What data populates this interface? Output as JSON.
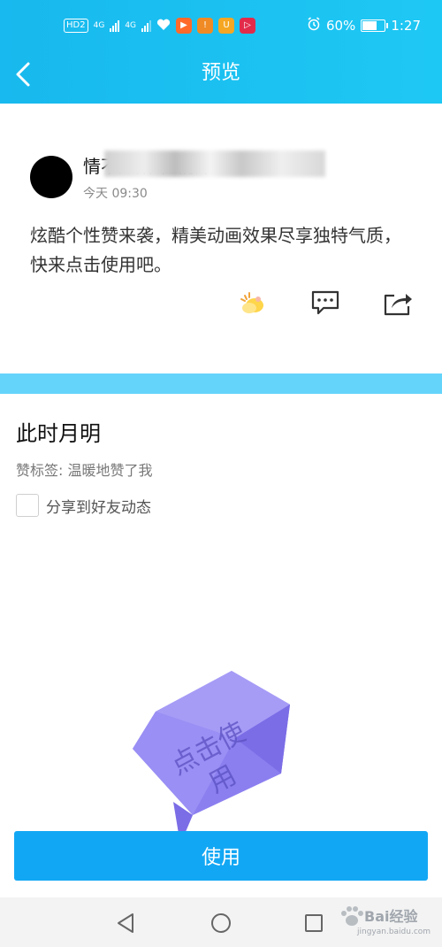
{
  "status_bar": {
    "network_label": "HD",
    "network_sub": "2",
    "signal_1": "4G",
    "signal_2": "4G",
    "battery": "60%",
    "time": "1:27"
  },
  "header": {
    "title": "预览"
  },
  "post": {
    "author_visible": "情不知所    住情深",
    "time": "今天 09:30",
    "text": "炫酷个性赞来袭，精美动画效果尽享独特气质，快来点击使用吧。"
  },
  "detail": {
    "title": "此时月明",
    "tag": "赞标签: 温暖地赞了我",
    "share_label": "分享到好友动态",
    "share_checked": false
  },
  "bubble": {
    "text_line1": "点击使",
    "text_line2": "用",
    "color": "#8b7ff0"
  },
  "use_button": {
    "label": "使用",
    "color": "#12a7f4"
  },
  "watermark": {
    "main": "Bai经验",
    "sub": "jingyan.baidu.com"
  },
  "colors": {
    "header_bg": "#1ec8f4",
    "divider": "#65d4fb"
  }
}
